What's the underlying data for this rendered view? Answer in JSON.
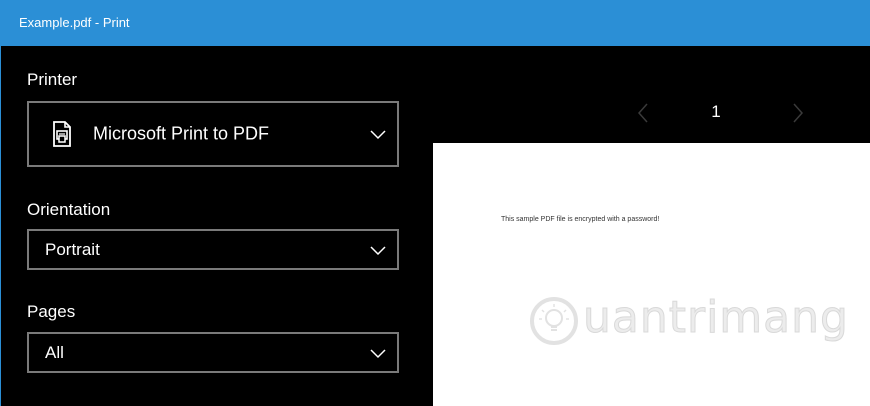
{
  "window": {
    "title": "Example.pdf - Print"
  },
  "settings": {
    "printer": {
      "label": "Printer",
      "value": "Microsoft Print to PDF",
      "icon": "printer-icon"
    },
    "orientation": {
      "label": "Orientation",
      "value": "Portrait"
    },
    "pages": {
      "label": "Pages",
      "value": "All"
    }
  },
  "preview": {
    "page_number": "1",
    "document_text": "This sample PDF file is encrypted with a password!",
    "watermark": "uantrimang"
  },
  "colors": {
    "accent": "#2b8fd6",
    "panel_bg": "#000000",
    "border": "#7a7a7a"
  }
}
